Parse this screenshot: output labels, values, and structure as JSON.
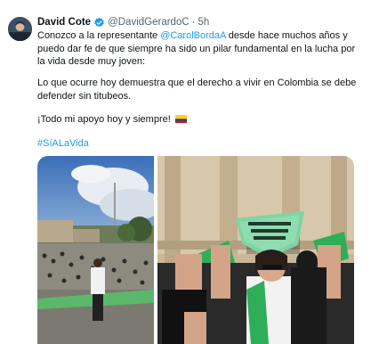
{
  "author": {
    "display_name": "David Cote",
    "handle": "@DavidGerardoC",
    "separator": "·",
    "timestamp": "5h",
    "avatar_icon": "user-avatar",
    "verified_icon": "verified-badge-icon",
    "verified_color": "#1d9bf0"
  },
  "tweet": {
    "p1_before": "Conozco a la representante ",
    "mention": "@CarolBordaA",
    "p1_after": " desde hace muchos años y puedo dar fe de que siempre ha sido un pilar fundamental en la lucha por la vida desde muy joven:",
    "p2": "Lo que ocurre hoy demuestra que el derecho a vivir en Colombia se debe defender sin titubeos.",
    "p3": "¡Todo mi apoyo hoy y siempre! ",
    "flag_icon": "colombia-flag-icon",
    "hashtag": "#SíALaVida"
  },
  "media": {
    "photos": [
      {
        "name": "photo-plaza-crowd"
      },
      {
        "name": "photo-rally-banner"
      }
    ]
  },
  "colors": {
    "link": "#1d9bf0",
    "secondary_text": "#536471",
    "primary_text": "#0f1419"
  }
}
